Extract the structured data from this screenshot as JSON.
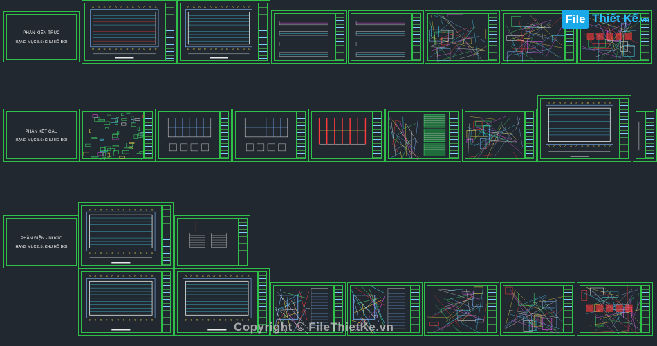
{
  "watermark": {
    "logo_prefix": "File",
    "logo_name": "Thiết Kế",
    "logo_suffix": ".vn",
    "copyright": "Copyright © FileThietKe.vn"
  },
  "sections": [
    {
      "line1": "PHẦN KIẾN TRÚC",
      "line2": "HẠNG MỤC 8.5: KHU HỒ BƠI"
    },
    {
      "line1": "PHẦN KẾT CẤU",
      "line2": "HẠNG MỤC 8.5: KHU HỒ BƠI"
    },
    {
      "line1": "PHẦN ĐIỆN - NƯỚC",
      "line2": "HẠNG MỤC 8.5: KHU HỒ BƠI"
    }
  ],
  "colors": {
    "background": "#212830",
    "frame": "#2fc04a",
    "line_blue": "#7fb8ff",
    "line_white": "#e8e8e8",
    "line_red": "#ff3b3b",
    "line_yellow": "#ffe04a",
    "line_cyan": "#47e0ff",
    "line_magenta": "#ff5cff",
    "line_green": "#3fe06a"
  }
}
